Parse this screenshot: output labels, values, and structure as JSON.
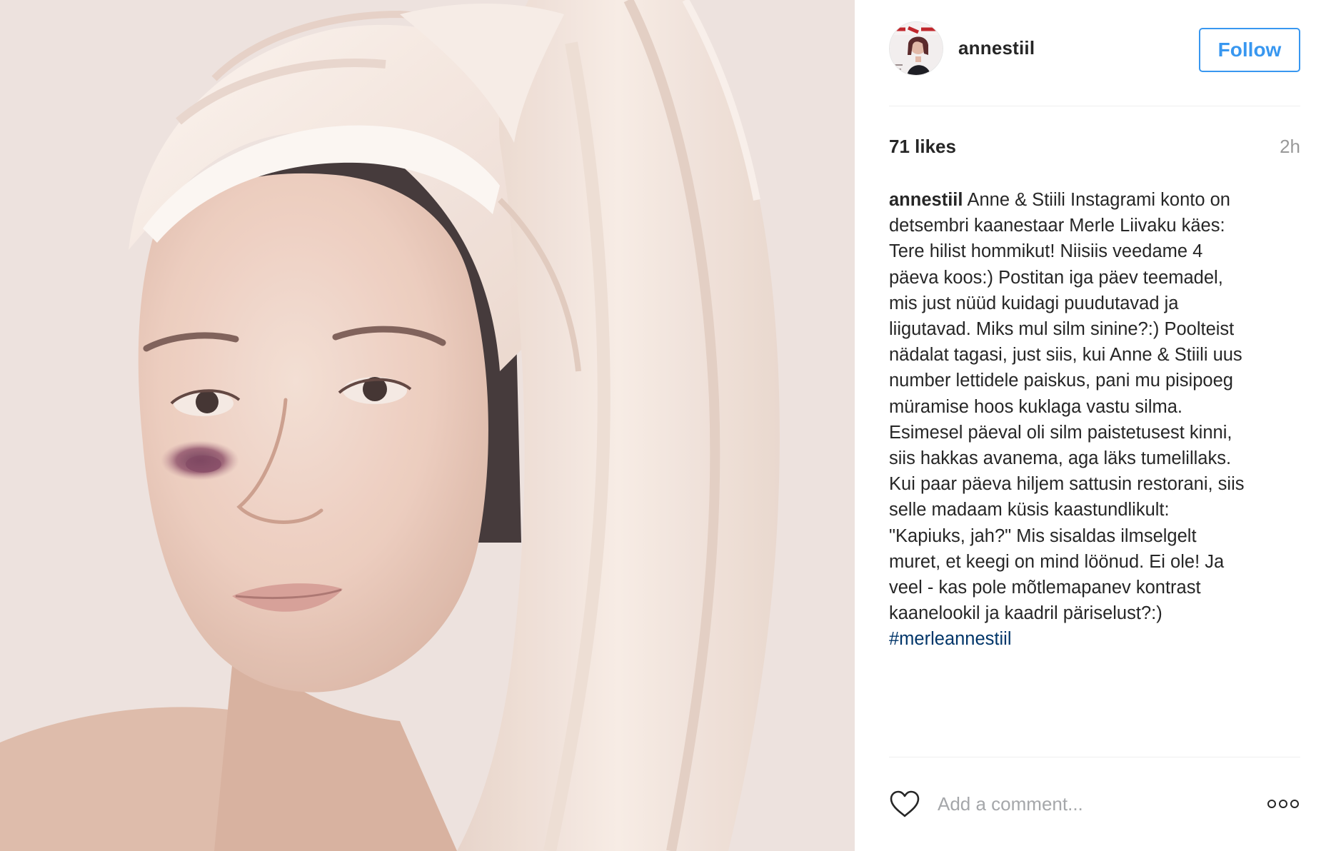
{
  "post": {
    "username": "annestiil",
    "follow_label": "Follow",
    "likes_text": "71 likes",
    "time_ago": "2h",
    "caption": {
      "username": "annestiil",
      "lines": [
        "Anne & Stiili Instagrami konto on",
        "detsembri kaanestaar Merle Liivaku käes:",
        "Tere hilist hommikut! Niisiis veedame 4",
        "päeva koos:) Postitan iga päev teemadel,",
        "mis just nüüd kuidagi puudutavad ja",
        "liigutavad. Miks mul silm sinine?:) Poolteist",
        "nädalat tagasi, just siis, kui Anne & Stiili uus",
        "number lettidele paiskus, pani mu pisipoeg",
        "müramise hoos kuklaga vastu silma.",
        "Esimesel päeval oli silm paistetusest kinni,",
        "siis hakkas avanema, aga läks tumelillaks.",
        "Kui paar päeva hiljem sattusin restorani, siis",
        "selle madaam küsis kaastundlikult:",
        "\"Kapiuks, jah?\" Mis sisaldas ilmselgelt",
        "muret, et keegi on mind löönud. Ei ole! Ja",
        "veel - kas pole mõtlemapanev kontrast",
        "kaanelookil ja kaadril päriselust?:)"
      ],
      "hashtag": "#merleannestiil"
    },
    "comment_placeholder": "Add a comment...",
    "icons": {
      "like": "heart-icon",
      "more": "more-options-icon"
    }
  },
  "colors": {
    "accent": "#3897f0",
    "text": "#262626",
    "muted": "#999999",
    "hashtag": "#003569",
    "divider": "#efefef"
  }
}
